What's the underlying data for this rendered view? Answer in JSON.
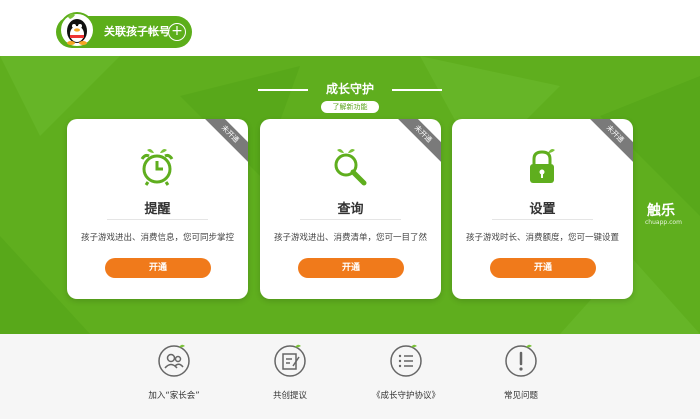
{
  "header": {
    "link_child_label": "关联孩子帐号"
  },
  "section": {
    "title": "成长守护",
    "learn_more": "了解新功能"
  },
  "cards": [
    {
      "title": "提醒",
      "desc": "孩子游戏进出、消费信息，您可同步掌控",
      "button": "开通",
      "badge": "未开通",
      "icon": "alarm-clock-icon"
    },
    {
      "title": "查询",
      "desc": "孩子游戏进出、消费清单，您可一目了然",
      "button": "开通",
      "badge": "未开通",
      "icon": "magnifier-icon"
    },
    {
      "title": "设置",
      "desc": "孩子游戏时长、消费额度，您可一键设置",
      "button": "开通",
      "badge": "未开通",
      "icon": "lock-icon"
    }
  ],
  "watermark": {
    "text": "触乐",
    "sub": "chuapp.com"
  },
  "footer": [
    {
      "label": "加入“家长会”",
      "icon": "parents-group-icon"
    },
    {
      "label": "共创提议",
      "icon": "suggestion-icon"
    },
    {
      "label": "《成长守护协议》",
      "icon": "agreement-icon"
    },
    {
      "label": "常见问题",
      "icon": "faq-icon"
    }
  ],
  "colors": {
    "brand_green": "#5fae1e",
    "button_orange": "#f07a1b",
    "badge_gray": "#7a7a7a"
  }
}
